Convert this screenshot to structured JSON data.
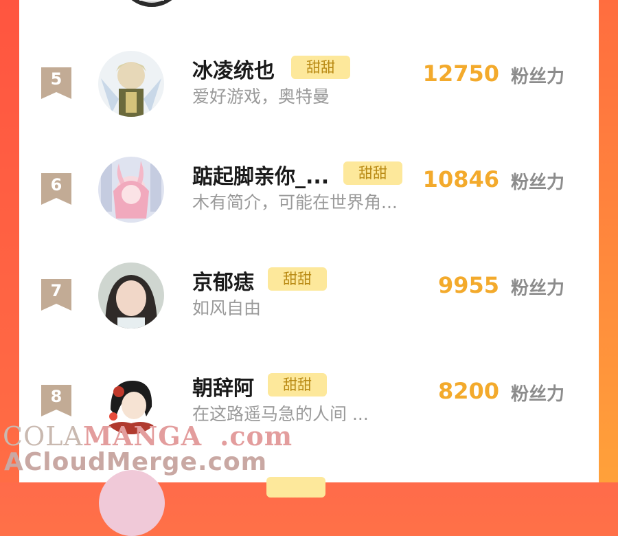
{
  "leaderboard": {
    "rows": [
      {
        "rank": "5",
        "name": "冰凌统也",
        "tag": "甜甜",
        "bio": "爱好游戏，奥特曼",
        "score": "12750",
        "unit": "粉丝力"
      },
      {
        "rank": "6",
        "name": "踮起脚亲你_...",
        "tag": "甜甜",
        "bio": "木有简介，可能在世界角...",
        "score": "10846",
        "unit": "粉丝力"
      },
      {
        "rank": "7",
        "name": "京郁痣",
        "tag": "甜甜",
        "bio": "如风自由",
        "score": "9955",
        "unit": "粉丝力"
      },
      {
        "rank": "8",
        "name": "朝辞阿",
        "tag": "甜甜",
        "bio": "在这路遥马急的人间  ...",
        "score": "8200",
        "unit": "粉丝力"
      }
    ]
  },
  "watermark": {
    "line1_prefix": "COLA",
    "line1_highlight": "MANGA",
    "line1_domain": ".com",
    "line2": "ACloudMerge.com"
  },
  "colors": {
    "score": "#f3aa2c",
    "tag_bg": "#fde89b",
    "badge": "#c2ab95",
    "frame_gradient_top": "#ff6b4a",
    "frame_gradient_bottom": "#ffa13a"
  }
}
